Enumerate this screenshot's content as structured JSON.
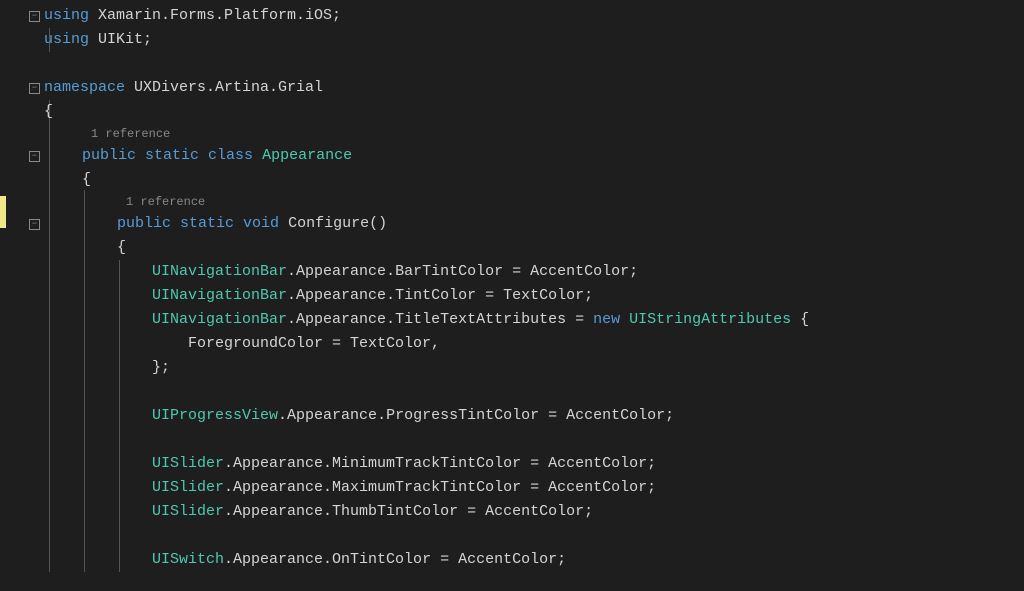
{
  "gutter": {
    "collapse": "−"
  },
  "codelens": {
    "ref1": "1 reference",
    "ref2": "1 reference"
  },
  "code": {
    "using1_kw": "using",
    "using1_ns": " Xamarin.Forms.Platform.iOS;",
    "using2_kw": "using",
    "using2_ns": " UIKit;",
    "ns_kw": "namespace",
    "ns_name": " UXDivers.Artina.Grial",
    "brace_open": "{",
    "brace_close": "}",
    "cls_pub": "public",
    "cls_static": " static",
    "cls_class": " class",
    "cls_name": " Appearance",
    "m_pub": "public",
    "m_static": " static",
    "m_void": " void",
    "m_name": " Configure()",
    "l1_a": "UINavigationBar",
    "l1_b": ".Appearance.BarTintColor = AccentColor;",
    "l2_a": "UINavigationBar",
    "l2_b": ".Appearance.TintColor = TextColor;",
    "l3_a": "UINavigationBar",
    "l3_b": ".Appearance.TitleTextAttributes = ",
    "l3_new": "new",
    "l3_c": " ",
    "l3_type": "UIStringAttributes",
    "l3_d": " {",
    "l4": "ForegroundColor = TextColor,",
    "l5": "};",
    "l6_a": "UIProgressView",
    "l6_b": ".Appearance.ProgressTintColor = AccentColor;",
    "l7_a": "UISlider",
    "l7_b": ".Appearance.MinimumTrackTintColor = AccentColor;",
    "l8_a": "UISlider",
    "l8_b": ".Appearance.MaximumTrackTintColor = AccentColor;",
    "l9_a": "UISlider",
    "l9_b": ".Appearance.ThumbTintColor = AccentColor;",
    "l10_a": "UISwitch",
    "l10_b": ".Appearance.OnTintColor = AccentColor;"
  }
}
